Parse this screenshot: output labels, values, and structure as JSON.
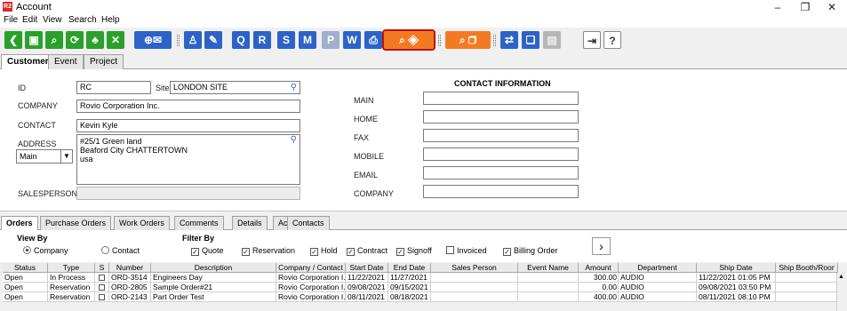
{
  "window": {
    "title": "Account",
    "logo_text": "R2",
    "minimize": "–",
    "restore": "❐",
    "close": "✕"
  },
  "menu": {
    "file": "File",
    "edit": "Edit",
    "view": "View",
    "search": "Search",
    "help": "Help"
  },
  "toolbar": {
    "buttons": [
      "back",
      "save",
      "search",
      "refresh",
      "hierarchy",
      "collapse",
      "add-email",
      "contacts",
      "edit",
      "quote-q",
      "report-r",
      "report-s",
      "report-m",
      "po",
      "wo",
      "print",
      "search-layers",
      "search-box",
      "pick",
      "docs",
      "disabled-doc",
      "exit",
      "help"
    ],
    "help_label": "?"
  },
  "tabs": {
    "customer": "Customer",
    "event": "Event",
    "project": "Project"
  },
  "customer": {
    "id_label": "ID",
    "id_value": "RC",
    "site_label": "Site",
    "site_value": "LONDON SITE",
    "company_label": "COMPANY",
    "company_value": "Rovio Corporation Inc.",
    "contact_label": "CONTACT",
    "contact_value": "Kevin Kyle",
    "address_label": "ADDRESS",
    "address_lines": [
      "#25/1 Green land",
      "Beaford City CHATTERTOWN",
      "usa"
    ],
    "address_type": "Main",
    "salesperson_label": "SALESPERSON",
    "salesperson_value": ""
  },
  "contact_info": {
    "header": "CONTACT INFORMATION",
    "main": "MAIN",
    "home": "HOME",
    "fax": "FAX",
    "mobile": "MOBILE",
    "email": "EMAIL",
    "company": "COMPANY"
  },
  "subtabs": {
    "orders": "Orders",
    "purchase_orders": "Purchase Orders",
    "work_orders": "Work Orders",
    "comments": "Comments",
    "details": "Details",
    "activity": "Activity",
    "contacts": "Contacts"
  },
  "filters": {
    "view_by_label": "View By",
    "company": "Company",
    "contact": "Contact",
    "filter_by_label": "Filter By",
    "quote": "Quote",
    "reservation": "Reservation",
    "hold": "Hold",
    "contract": "Contract",
    "signoff": "Signoff",
    "invoiced": "Invoiced",
    "billing_order": "Billing Order",
    "next": "›"
  },
  "grid": {
    "columns": [
      "Status",
      "Type",
      "S",
      "Number",
      "Description",
      "Company / Contact",
      "Start Date",
      "End Date",
      "Sales Person",
      "Event Name",
      "Amount",
      "Department",
      "Ship Date",
      "Ship Booth/Roor"
    ],
    "rows": [
      [
        "Open",
        "In Process",
        "",
        "ORD-3514",
        "Engineers Day",
        "Rovio Corporation I...",
        "11/22/2021 ...",
        "11/27/2021 ...",
        "",
        "",
        "300.00",
        "AUDIO",
        "11/22/2021 01:05 PM",
        ""
      ],
      [
        "Open",
        "Reservation",
        "",
        "ORD-2805",
        "Sample Order#21",
        "Rovio Corporation I...",
        "09/08/2021 ...",
        "09/15/2021 ...",
        "",
        "",
        "0.00",
        "AUDIO",
        "09/08/2021 03:50 PM",
        ""
      ],
      [
        "Open",
        "Reservation",
        "",
        "ORD-2143",
        "Part Order Test",
        "Rovio Corporation I...",
        "08/11/2021 ...",
        "08/18/2021 ...",
        "",
        "",
        "400.00",
        "AUDIO",
        "08/11/2021 08:10 PM",
        ""
      ]
    ]
  }
}
